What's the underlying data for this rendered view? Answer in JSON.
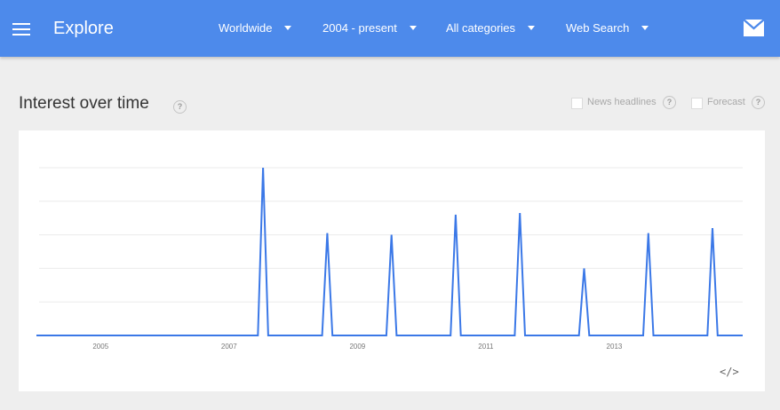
{
  "header": {
    "title": "Explore",
    "filters": {
      "region": "Worldwide",
      "time_range": "2004 - present",
      "category": "All categories",
      "search_type": "Web Search"
    }
  },
  "section": {
    "title": "Interest over time",
    "help_glyph": "?",
    "options": {
      "news_headlines": "News headlines",
      "forecast": "Forecast"
    }
  },
  "colors": {
    "header_bg": "#4d8aeb",
    "line": "#3b78e7"
  },
  "icons": {
    "menu": "hamburger-menu-icon",
    "mail": "mail-icon",
    "embed": "code-embed-icon",
    "help": "help-question-icon"
  },
  "embed": {
    "glyph": "</>"
  },
  "chart_data": {
    "type": "line",
    "ylim": [
      0,
      100
    ],
    "xlim": [
      2004,
      2015
    ],
    "grid": true,
    "x_ticks": [
      2005,
      2007,
      2009,
      2011,
      2013
    ],
    "x_tick_labels": [
      "2005",
      "2007",
      "2009",
      "2011",
      "2013"
    ],
    "series": [
      {
        "x": [
          2004.0,
          2007.45,
          2007.53,
          2007.61,
          2008.45,
          2008.53,
          2008.61,
          2009.45,
          2009.53,
          2009.61,
          2010.45,
          2010.53,
          2010.61,
          2011.45,
          2011.53,
          2011.61,
          2012.45,
          2012.53,
          2012.61,
          2013.45,
          2013.53,
          2013.61,
          2014.45,
          2014.53,
          2014.61,
          2015.0
        ],
        "y": [
          0,
          0,
          100,
          0,
          0,
          61,
          0,
          0,
          60,
          0,
          0,
          72,
          0,
          0,
          73,
          0,
          0,
          40,
          0,
          0,
          61,
          0,
          0,
          64,
          0,
          0
        ]
      }
    ]
  }
}
